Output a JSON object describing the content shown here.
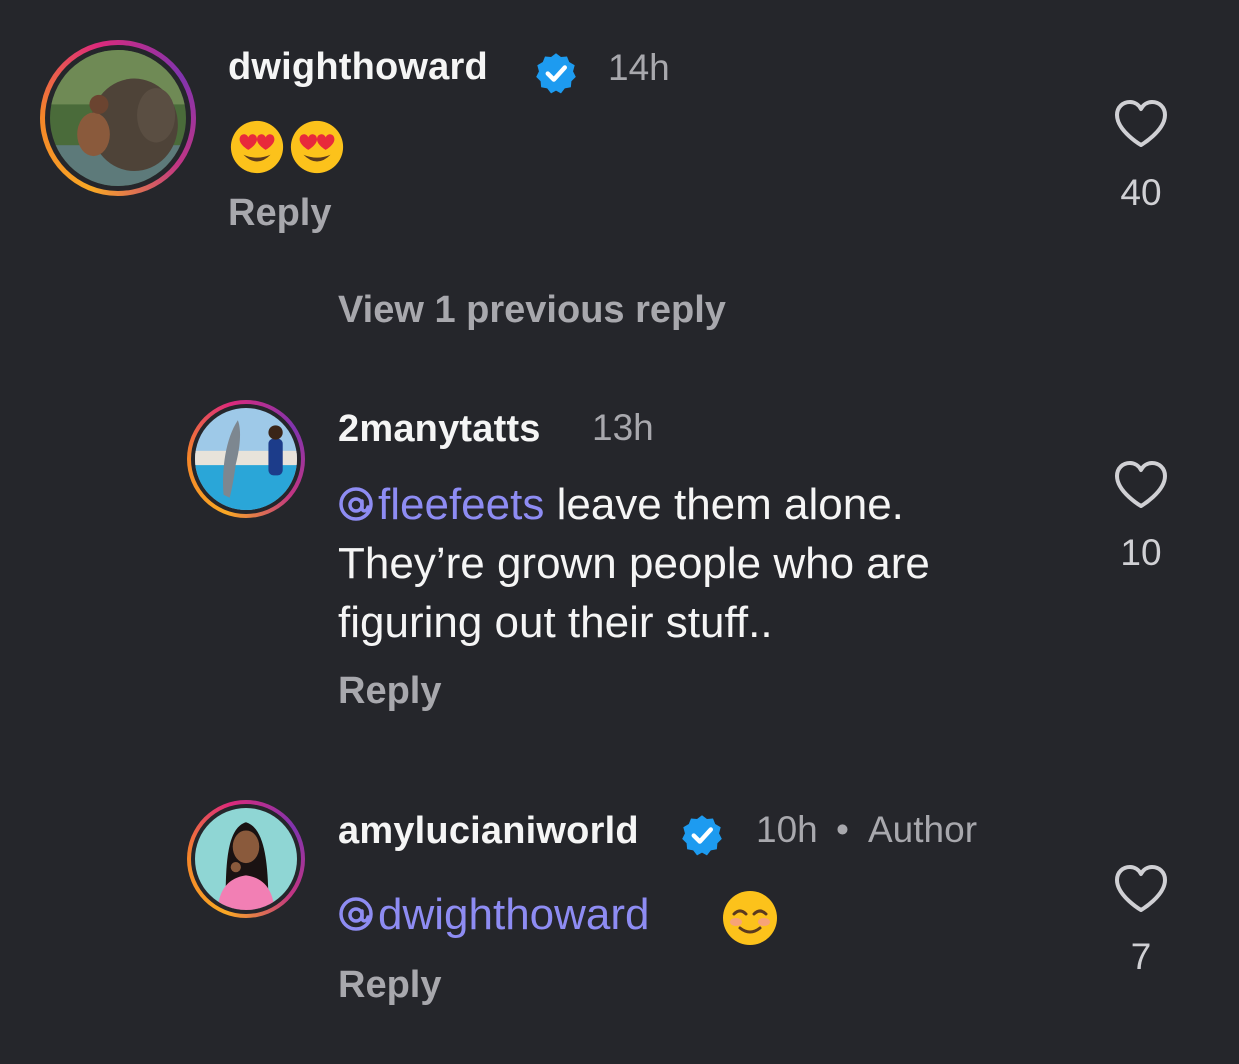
{
  "comments": [
    {
      "username": "dwighthoward",
      "verified": true,
      "time": "14h",
      "emojis": [
        "smiling-heart-eyes",
        "smiling-heart-eyes"
      ],
      "reply_label": "Reply",
      "likes": "40"
    },
    {
      "username": "2manytatts",
      "verified": false,
      "time": "13h",
      "mention": "fleefeets",
      "text_after_mention": " leave them alone.",
      "text_line2": "They’re grown people who are",
      "text_line3": "figuring out their stuff..",
      "reply_label": "Reply",
      "likes": "10"
    },
    {
      "username": "amylucianiworld",
      "verified": true,
      "time": "10h",
      "separator": "•",
      "author_label": "Author",
      "mention": "dwighthoward",
      "emoji": "smiling-face",
      "reply_label": "Reply",
      "likes": "7"
    }
  ],
  "view_previous": "View 1 previous reply",
  "colors": {
    "background": "#25262b",
    "mention": "#8e8cf3",
    "verified": "#1d9bf0",
    "muted": "#a8a8ad"
  }
}
